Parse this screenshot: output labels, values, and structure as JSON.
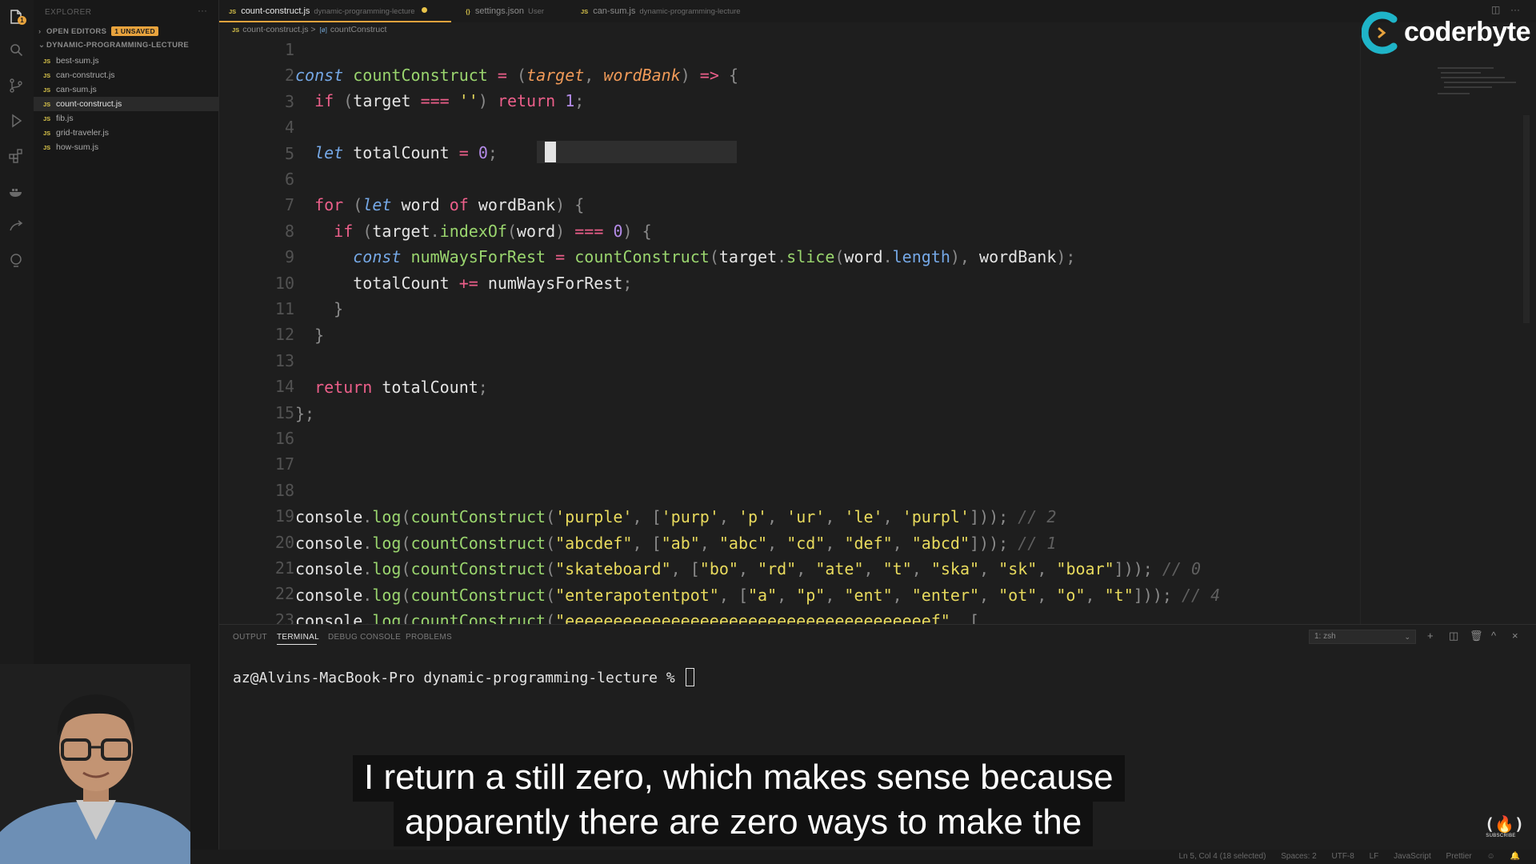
{
  "sidebar": {
    "title": "EXPLORER",
    "more": "···",
    "open_editors": "OPEN EDITORS",
    "unsaved_badge": "1 UNSAVED",
    "folder": "DYNAMIC-PROGRAMMING-LECTURE",
    "file_icon": "JS",
    "files": [
      "best-sum.js",
      "can-construct.js",
      "can-sum.js",
      "count-construct.js",
      "fib.js",
      "grid-traveler.js",
      "how-sum.js"
    ],
    "active_file": "count-construct.js"
  },
  "activity": {
    "badge": "1"
  },
  "tabs": [
    {
      "icon": "JS",
      "name": "count-construct.js",
      "desc": "dynamic-programming-lecture",
      "active": true
    },
    {
      "icon": "{}",
      "name": "settings.json",
      "desc": "User",
      "active": false
    },
    {
      "icon": "JS",
      "name": "can-sum.js",
      "desc": "dynamic-programming-lecture",
      "active": false
    }
  ],
  "breadcrumb": {
    "file": "count-construct.js",
    "separator": ">",
    "symbol_icon": "[ø]",
    "symbol": "countConstruct"
  },
  "editor": {
    "line_numbers": [
      "1",
      "2",
      "3",
      "4",
      "5",
      "6",
      "7",
      "8",
      "9",
      "10",
      "11",
      "12",
      "13",
      "14",
      "15",
      "16",
      "17",
      "18",
      "19",
      "20",
      "21",
      "22",
      "23"
    ]
  },
  "logo": {
    "brand": "coderbyte",
    "mark_icon": "coderbyte-logo-icon"
  },
  "panel": {
    "tabs": [
      "OUTPUT",
      "TERMINAL",
      "DEBUG CONSOLE",
      "PROBLEMS"
    ],
    "active_tab": "TERMINAL",
    "shell": "1: zsh",
    "prompt": "az@Alvins-MacBook-Pro dynamic-programming-lecture % "
  },
  "status": {
    "position": "Ln 5, Col 4 (18 selected)",
    "spaces": "Spaces: 2",
    "encoding": "UTF-8",
    "eol": "LF",
    "language": "JavaScript",
    "formatter": "Prettier"
  },
  "subtitles": {
    "line1": "I return a still zero, which makes sense because",
    "line2": "apparently there are zero ways to make the"
  },
  "fcc": {
    "glyph": "(🔥)",
    "label": "SUBSCRIBE"
  },
  "colors": {
    "accent": "#e8a33d",
    "keyword": "#ec5f8a",
    "function": "#9ad56e",
    "string": "#e8da5d",
    "number": "#b48be8",
    "param": "#f09a58",
    "storage": "#75a8e6"
  }
}
